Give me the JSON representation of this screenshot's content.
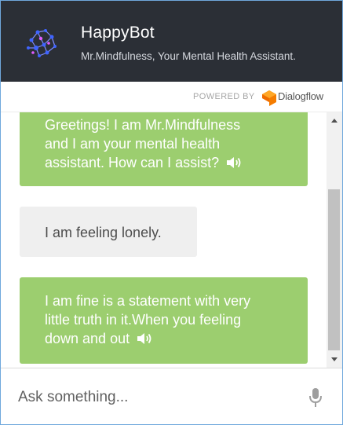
{
  "header": {
    "title": "HappyBot",
    "subtitle": "Mr.Mindfulness, Your Mental Health Assistant.",
    "logo_icon": "network-brain-icon"
  },
  "powered_by": {
    "label": "POWERED BY",
    "brand": "Dialogflow",
    "brand_icon": "dialogflow-icon",
    "brand_color": "#f57c00"
  },
  "messages": [
    {
      "sender": "bot",
      "lines": [
        "Greetings! I am Mr.Mindfulness",
        "and I am your mental health",
        "assistant. How can I assist?"
      ],
      "icon": "speaker-icon"
    },
    {
      "sender": "user",
      "lines": [
        "I am feeling lonely."
      ]
    },
    {
      "sender": "bot",
      "lines": [
        "I am fine is a statement with very",
        "little truth in it.When you feeling",
        "down and out"
      ],
      "icon": "speaker-icon"
    }
  ],
  "input": {
    "placeholder": "Ask something...",
    "value": "",
    "mic_icon": "microphone-icon"
  },
  "colors": {
    "header_bg": "#2b2f36",
    "bot_bubble": "#9cce6f",
    "user_bubble": "#efefef"
  }
}
